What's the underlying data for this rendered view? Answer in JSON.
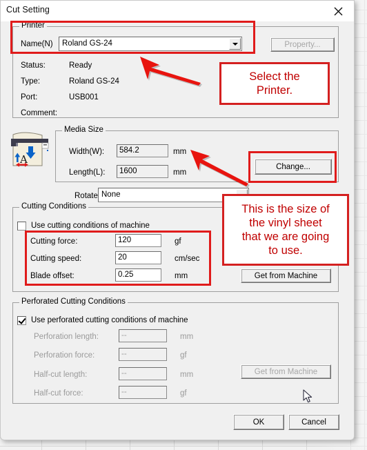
{
  "window": {
    "title": "Cut Setting",
    "close_icon": "close-icon"
  },
  "printer_group": {
    "legend": "Printer",
    "name_label": "Name(N)",
    "name_value": "Roland GS-24",
    "property_button": "Property...",
    "rows": [
      {
        "label": "Status:",
        "value": "Ready"
      },
      {
        "label": "Type:",
        "value": "Roland GS-24"
      },
      {
        "label": "Port:",
        "value": "USB001"
      },
      {
        "label": "Comment:",
        "value": ""
      }
    ]
  },
  "media_size": {
    "legend": "Media Size",
    "width_label": "Width(W):",
    "width_value": "584.2",
    "width_unit": "mm",
    "length_label": "Length(L):",
    "length_value": "1600",
    "length_unit": "mm",
    "change_button": "Change...",
    "icon": "media-sheet-icon"
  },
  "rotate": {
    "label": "Rotate:",
    "value": "None"
  },
  "cutting_conditions": {
    "legend": "Cutting Conditions",
    "checkbox_label": "Use cutting conditions of machine",
    "checkbox_checked": false,
    "rows": [
      {
        "label": "Cutting force:",
        "value": "120",
        "unit": "gf"
      },
      {
        "label": "Cutting speed:",
        "value": "20",
        "unit": "cm/sec"
      },
      {
        "label": "Blade offset:",
        "value": "0.25",
        "unit": "mm"
      }
    ],
    "get_button": "Get from Machine"
  },
  "perforated_conditions": {
    "legend": "Perforated Cutting Conditions",
    "checkbox_label": "Use perforated cutting conditions of machine",
    "checkbox_checked": true,
    "rows": [
      {
        "label": "Perforation length:",
        "value": "--",
        "unit": "mm"
      },
      {
        "label": "Perforation  force:",
        "value": "--",
        "unit": "gf"
      },
      {
        "label": "Half-cut length:",
        "value": "--",
        "unit": "mm"
      },
      {
        "label": "Half-cut force:",
        "value": "--",
        "unit": "gf"
      }
    ],
    "get_button": "Get from Machine"
  },
  "footer": {
    "ok_button": "OK",
    "cancel_button": "Cancel"
  },
  "annotations": {
    "color": "#c00000",
    "box_color": "#d42020",
    "note_printer": "Select the\nPrinter.",
    "note_printer_lines": [
      "Select the",
      "Printer."
    ],
    "note_media": "This is the size of the vinyl sheet that we are going to use.",
    "note_media_lines": [
      "This is the size of",
      "the vinyl sheet",
      "that we are going",
      "to use."
    ]
  },
  "cursor": {
    "icon": "mouse-pointer-icon"
  }
}
